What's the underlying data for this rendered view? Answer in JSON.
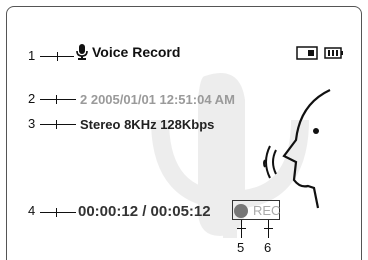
{
  "screen": {
    "title": "Voice Record",
    "file_line": "2  2005/01/01  12:51:04 AM",
    "audio_line": "Stereo  8KHz  128Kbps",
    "time_line": "00:00:12 / 00:05:12",
    "rec_label": "REC"
  },
  "callouts": [
    "1",
    "2",
    "3",
    "4",
    "5",
    "6"
  ],
  "icons": {
    "mic": "microphone-icon",
    "memory": "memory-card-icon",
    "battery": "battery-icon",
    "speaker": "speaker-head-icon",
    "record": "record-dot-icon"
  },
  "colors": {
    "primary_text": "#111111",
    "dim_text": "#9a9a9a",
    "rec_dot": "#777777"
  }
}
